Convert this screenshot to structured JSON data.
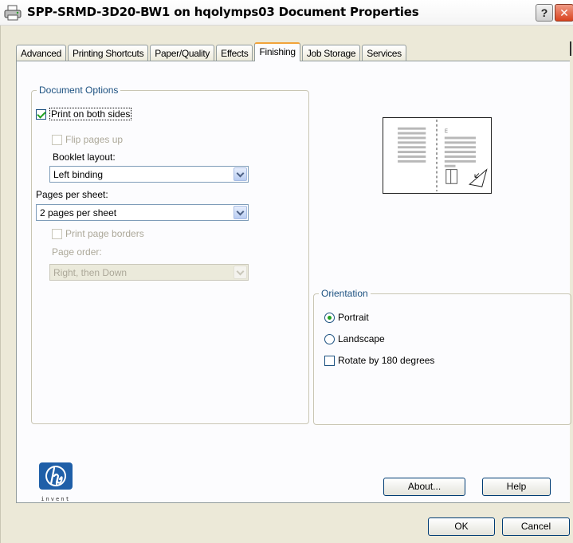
{
  "window": {
    "title": "SPP-SRMD-3D20-BW1 on hqolymps03 Document Properties",
    "help_glyph": "?",
    "close_glyph": "✕"
  },
  "tabs": [
    {
      "label": "Advanced"
    },
    {
      "label": "Printing Shortcuts"
    },
    {
      "label": "Paper/Quality"
    },
    {
      "label": "Effects"
    },
    {
      "label": "Finishing",
      "active": true
    },
    {
      "label": "Job Storage"
    },
    {
      "label": "Services"
    }
  ],
  "document_options": {
    "title": "Document Options",
    "print_both_sides": {
      "label": "Print on both sides",
      "checked": true
    },
    "flip_pages_up": {
      "label": "Flip pages up",
      "checked": false,
      "disabled": true
    },
    "booklet_layout": {
      "label": "Booklet layout:",
      "value": "Left binding"
    },
    "pages_per_sheet": {
      "label": "Pages per sheet:",
      "value": "2 pages per sheet"
    },
    "print_page_borders": {
      "label": "Print page borders",
      "checked": false,
      "disabled": true
    },
    "page_order": {
      "label": "Page order:",
      "value": "Right, then Down",
      "disabled": true
    }
  },
  "orientation": {
    "title": "Orientation",
    "portrait": {
      "label": "Portrait",
      "selected": true
    },
    "landscape": {
      "label": "Landscape",
      "selected": false
    },
    "rotate_180": {
      "label": "Rotate by 180 degrees",
      "checked": false
    }
  },
  "branding": {
    "logo_text": "hp",
    "tagline": "invent"
  },
  "buttons": {
    "about": "About...",
    "help": "Help",
    "ok": "OK",
    "cancel": "Cancel"
  },
  "colors": {
    "dialog_bg": "#ece9d8",
    "group_title": "#1c5180",
    "check_mark": "#21a121",
    "active_tab_accent": "#f2a33a",
    "hp_blue": "#1f5fa8"
  }
}
